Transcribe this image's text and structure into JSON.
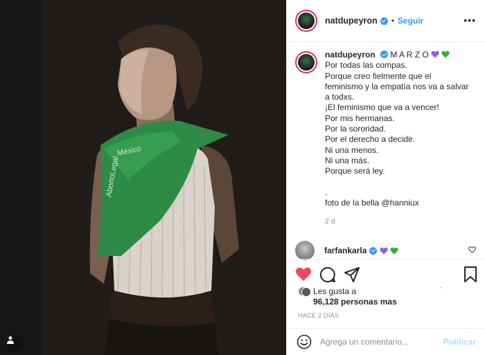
{
  "post": {
    "author": "natdupeyron",
    "follow_label": "Seguir",
    "dot": "•",
    "caption_title": "M A R Z O",
    "caption_lines": [
      "Por todas las compas.",
      "Porque creo fielmente que el",
      "feminismo y la empatía nos va a salvar",
      "a todxs.",
      "¡El feminismo que va a vencer!",
      "Por mis hermanas.",
      "Por la sororidad.",
      "Por el derecho a decidir.",
      "Ni una menos.",
      "Ni una más.",
      "Porque será ley.",
      "",
      ".",
      "foto de la bella @hanniux"
    ],
    "caption_age": "2 d",
    "heart_colors": [
      "#8a63d2",
      "#2fb32f"
    ]
  },
  "reply": {
    "author": "farfankarla"
  },
  "likes": {
    "line1": "Les gusta a",
    "count": "96,128 personas mas"
  },
  "timestamp": "HACE 2 DÍAS",
  "comment": {
    "placeholder": "Agrega un comentario...",
    "publish_label": "Publicar"
  },
  "colors": {
    "accent": "#3897f0",
    "like_red": "#ed4956",
    "bandana_green": "#2e8b47"
  },
  "icons": [
    "heart-icon",
    "comment-icon",
    "share-icon",
    "bookmark-icon",
    "emoji-icon",
    "verified-icon",
    "more-icon",
    "user-tag-icon"
  ]
}
